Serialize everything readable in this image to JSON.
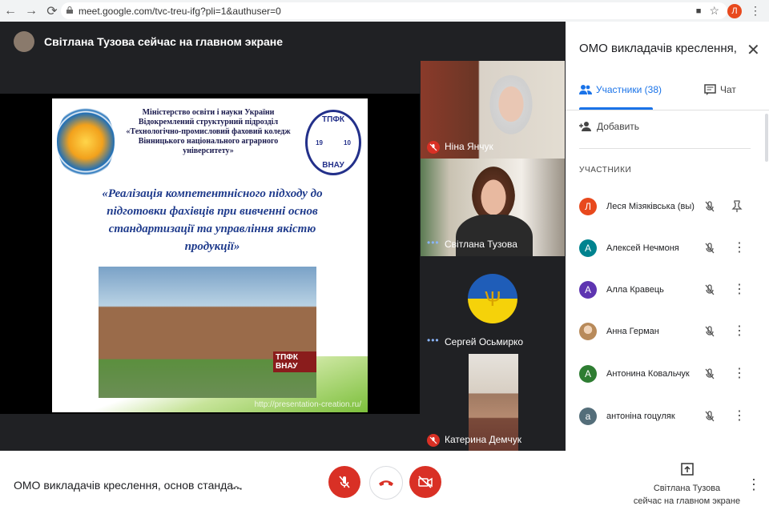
{
  "browser": {
    "url": "meet.google.com/tvc-treu-ifg?pli=1&authuser=0",
    "profile_initial": "Л"
  },
  "presenter_banner": "Світлана Тузова сейчас на главном экране",
  "slide": {
    "ministry_text": "Міністерство освіти і науки України Відокремлений структурний підрозділ «Технологічно-промисловий фаховий коледж Вінницького національного аграрного університету»",
    "quote": "«Реалізація компетентнісного підходу до підготовки фахівців при вивченні основ стандартизації та управління якістю продукції»",
    "logo_right_top": "ТПФК",
    "logo_right_bottom": "ВНАУ",
    "logo_year_left": "19",
    "logo_year_right": "10",
    "building_sign": "ТПФК ВНАУ",
    "footer_url": "http://presentation-creation.ru/"
  },
  "tiles": [
    {
      "name": "Ніна Янчук",
      "muted": true
    },
    {
      "name": "Світлана Тузова",
      "muted": false
    },
    {
      "name": "Сергей Осьмирко",
      "muted": false
    },
    {
      "name": "Катерина Демчук",
      "muted": true
    }
  ],
  "panel": {
    "title": "ОМО викладачів креслення, ос...",
    "tab_people": "Участники (38)",
    "tab_chat": "Чат",
    "add_label": "Добавить",
    "section_label": "УЧАСТНИКИ",
    "participants": [
      {
        "initial": "Л",
        "name": "Леся Мізяківська (вы)",
        "color": "#e8491d"
      },
      {
        "initial": "А",
        "name": "Алексей Нечмоня",
        "color": "#00838f"
      },
      {
        "initial": "А",
        "name": "Алла Кравець",
        "color": "#5e35b1"
      },
      {
        "initial": "",
        "name": "Анна Герман",
        "color": "#c9a27a"
      },
      {
        "initial": "А",
        "name": "Антонина Ковальчук",
        "color": "#2e7d32"
      },
      {
        "initial": "а",
        "name": "антоніна гоцуляк",
        "color": "#546e7a"
      }
    ]
  },
  "bottom": {
    "meeting_name": "ОМО викладачів креслення, основ станда...",
    "present_line1": "Світлана Тузова",
    "present_line2": "сейчас на главном экране"
  },
  "colors": {
    "accent": "#1a73e8",
    "danger": "#d93025",
    "stage": "#202124"
  }
}
